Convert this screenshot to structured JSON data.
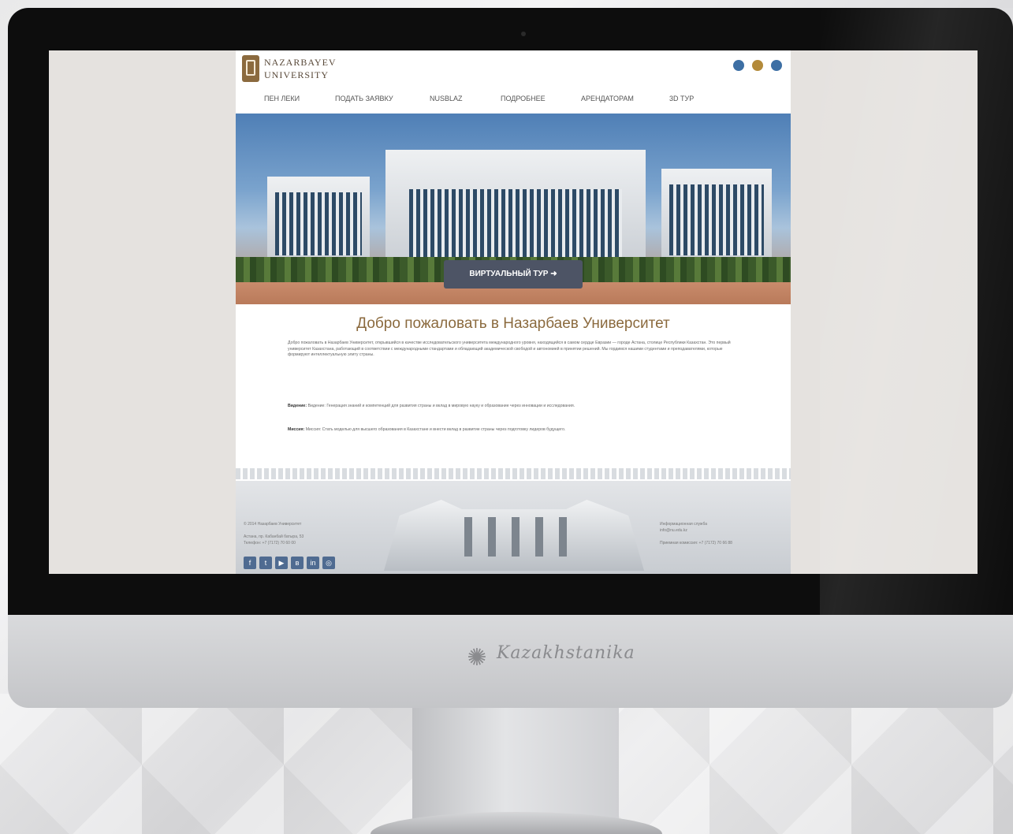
{
  "site": {
    "logo_line1": "NAZARBAYEV",
    "logo_line2": "UNIVERSITY",
    "languages": [
      {
        "icon": "flag-kz-icon",
        "color": "#3d6fa4"
      },
      {
        "icon": "flag-ru-icon",
        "color": "#b38a3a"
      },
      {
        "icon": "flag-en-icon",
        "color": "#3d6fa4"
      }
    ],
    "nav": [
      "ПЕН ЛЕКИ",
      "ПОДАТЬ ЗАЯВКУ",
      "NUSBLAZ",
      "ПОДРОБНЕЕ",
      "АРЕНДАТОРАМ",
      "3D ТУР"
    ],
    "hero_button": "ВИРТУАЛЬНЫЙ ТУР",
    "hero_button_icon": "arrow-right-icon",
    "welcome_title": "Добро пожаловать в Назарбаев Университет",
    "paragraphs": [
      "Добро пожаловать в Назарбаев Университет, открывшийся в качестве исследовательского университета международного уровня, находящийся в самом сердце Евразии — городе Астана, столице Республики Казахстан. Это первый университет Казахстана, работающий в соответствии с международными стандартами и обладающий академической свободой и автономией в принятии решений. Мы гордимся нашими студентами и преподавателями, которые формируют интеллектуальную элиту страны.",
      "Видение: Генерация знаний и компетенций для развития страны и вклад в мировую науку и образование через инновации и исследования.",
      "Миссия: Стать моделью для высшего образования в Казахстане и внести вклад в развитие страны через подготовку лидеров будущего."
    ],
    "paragraph_labels": [
      "",
      "Видение:",
      "Миссия:"
    ],
    "footer_left": [
      "© 2014 Назарбаев Университет",
      "Астана, пр. Кабанбай батыра, 53",
      "Телефон: +7 (7172) 70 60 00"
    ],
    "footer_right": [
      "Информационная служба",
      "info@nu.edu.kz",
      "Приемная комиссия: +7 (7172) 70 66 88"
    ],
    "social": [
      "facebook-icon",
      "twitter-icon",
      "youtube-icon",
      "vk-icon",
      "linkedin-icon",
      "instagram-icon"
    ],
    "social_glyphs": [
      "f",
      "t",
      "▶",
      "в",
      "in",
      "◎"
    ]
  },
  "monitor": {
    "brand_text": "Kazakhstanika"
  }
}
